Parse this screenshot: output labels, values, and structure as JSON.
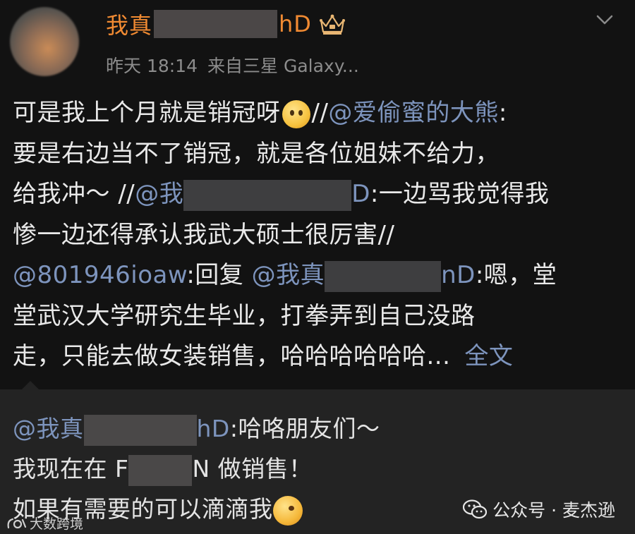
{
  "post": {
    "author_name_start": "我真",
    "author_name_end": "hD",
    "time": "昨天 18:14",
    "source": "来自三星 Galaxy...",
    "body": {
      "l1_text": "可是我上个月就是销冠呀",
      "l1_sep": "//",
      "l1_mention": "@爱偷蜜的大熊",
      "l1_colon": ":",
      "l2": "要是右边当不了销冠，就是各位姐妹不给力，",
      "l3_text": "给我冲～",
      "l3_sep": "//",
      "l3_mention_start": "@我",
      "l3_mention_end": "D",
      "l3_rest": ":一边骂我觉得我",
      "l4": "惨一边还得承认我武大硕士很厉害//",
      "l5_mention1": "@801946ioaw",
      "l5_text": ":回复",
      "l5_mention2_start": "@我真",
      "l5_mention2_end": "nD",
      "l5_rest": ":嗯，堂",
      "l6": "堂武汉大学研究生毕业，打拳弄到自己没路",
      "l7": "走，只能去做女装销售，哈哈哈哈哈哈...",
      "full_text_link": "全文"
    }
  },
  "repost": {
    "r1_mention_start": "@我真",
    "r1_mention_end": "hD",
    "r1_rest": ":哈咯朋友们～",
    "r2_start": "我现在在 F",
    "r2_end": "N 做销售！",
    "r3": "如果有需要的可以滴滴我"
  },
  "watermarks": {
    "right": "公众号 · 麦杰逊",
    "left": "大数跨境"
  },
  "colors": {
    "background": "#121212",
    "repost_background": "#232323",
    "username": "#f08a32",
    "mention": "#7d94bd",
    "meta": "#8c8c8c"
  }
}
